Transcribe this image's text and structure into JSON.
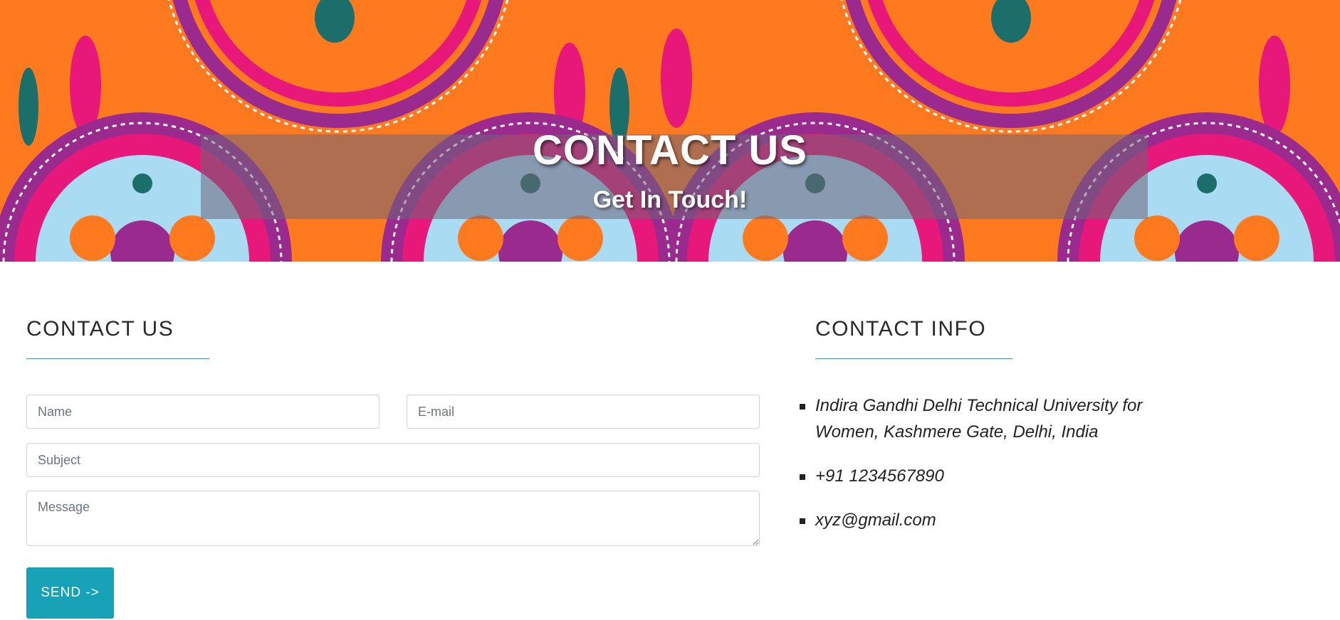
{
  "hero": {
    "title": "CONTACT US",
    "subtitle": "Get In Touch!",
    "pattern_colors": [
      "#ff7a1f",
      "#9b2a8f",
      "#e8177a",
      "#a9dcf2",
      "#1c6e6a",
      "#ffffff"
    ]
  },
  "contact_form": {
    "heading": "CONTACT US",
    "name_placeholder": "Name",
    "email_placeholder": "E-mail",
    "subject_placeholder": "Subject",
    "message_placeholder": "Message",
    "send_label": "SEND ->"
  },
  "contact_info": {
    "heading": "CONTACT INFO",
    "address": "Indira Gandhi Delhi Technical University for Women, Kashmere Gate, Delhi, India",
    "phone": "+91 1234567890",
    "email": "xyz@gmail.com"
  },
  "colors": {
    "accent": "#17a2b8"
  }
}
